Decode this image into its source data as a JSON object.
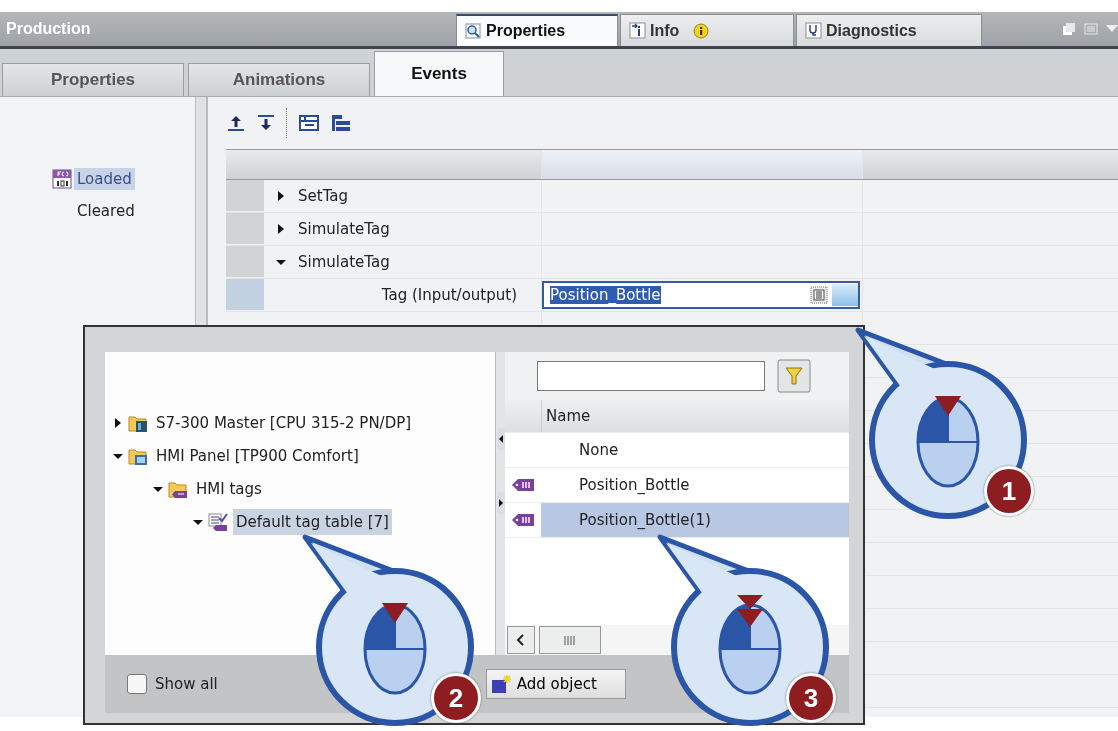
{
  "panel": {
    "title": "Production",
    "tabs": [
      {
        "label": "Properties",
        "kind": "properties",
        "selected": true,
        "notice": false
      },
      {
        "label": "Info",
        "kind": "info",
        "selected": false,
        "notice": true
      },
      {
        "label": "Diagnostics",
        "kind": "diagnostics",
        "selected": false,
        "notice": false
      }
    ]
  },
  "subtabs": [
    {
      "label": "Properties",
      "selected": false
    },
    {
      "label": "Animations",
      "selected": false
    },
    {
      "label": "Events",
      "selected": true
    }
  ],
  "events": [
    {
      "label": "Loaded",
      "selected": true,
      "configured": true
    },
    {
      "label": "Cleared",
      "selected": false,
      "configured": false
    }
  ],
  "functions": [
    {
      "name": "SetTag",
      "expanded": false
    },
    {
      "name": "SimulateTag",
      "expanded": false
    },
    {
      "name": "SimulateTag",
      "expanded": true,
      "params": [
        {
          "label": "Tag (Input/output)",
          "value": "Position_Bottle",
          "highlighted": true
        }
      ]
    }
  ],
  "tag_dialog": {
    "tree": [
      {
        "label": "S7-300 Master [CPU 315-2 PN/DP]",
        "kind": "station",
        "expanded": false,
        "selected": false
      },
      {
        "label": "HMI Panel [TP900 Comfort]",
        "kind": "panel",
        "expanded": true,
        "selected": false,
        "children": [
          {
            "label": "HMI tags",
            "kind": "folder",
            "expanded": true,
            "selected": false,
            "children": [
              {
                "label": "Default tag table [7]",
                "kind": "table",
                "expanded": true,
                "selected": true
              }
            ]
          }
        ]
      }
    ],
    "column": "Name",
    "tags": [
      {
        "name": "None",
        "kind": "none",
        "selected": false
      },
      {
        "name": "Position_Bottle",
        "kind": "tag",
        "selected": false
      },
      {
        "name": "Position_Bottle(1)",
        "kind": "tag",
        "selected": true
      }
    ],
    "show_all": {
      "label": "Show all",
      "checked": false
    },
    "add_button": "Add object"
  },
  "callouts": [
    {
      "number": "1",
      "double_click": false
    },
    {
      "number": "2",
      "double_click": false
    },
    {
      "number": "3",
      "double_click": true
    }
  ]
}
